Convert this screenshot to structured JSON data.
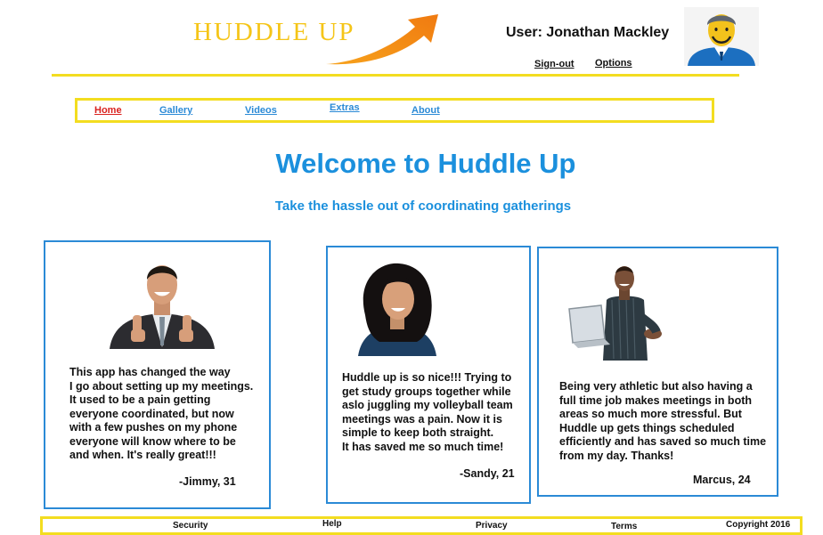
{
  "header": {
    "logo_text": "HUDDLE UP",
    "user_label": "User: Jonathan Mackley",
    "signout_label": "Sign-out",
    "options_label": "Options"
  },
  "nav": {
    "items": [
      {
        "label": "Home",
        "active": true
      },
      {
        "label": "Gallery"
      },
      {
        "label": "Videos"
      },
      {
        "label": "Extras"
      },
      {
        "label": "About"
      }
    ]
  },
  "hero": {
    "title": "Welcome to Huddle Up",
    "subtitle": "Take the hassle out of coordinating gatherings"
  },
  "testimonials": [
    {
      "lines": [
        "This app has changed the way",
        "I go about setting up my meetings.",
        "It used to be a pain getting",
        "everyone coordinated, but now",
        "with a few pushes on my phone",
        "everyone will know where to be",
        "and when. It's really great!!!"
      ],
      "signature": "-Jimmy, 31"
    },
    {
      "lines": [
        "Huddle up is so nice!!! Trying to",
        "get study groups together while",
        "aslo juggling my volleyball team",
        "meetings was a pain. Now it is",
        "simple to keep both straight.",
        "It has saved me so much time!"
      ],
      "signature": "-Sandy, 21"
    },
    {
      "lines": [
        "Being very athletic but also having a",
        "full time job makes meetings in both",
        "areas so much more stressful. But",
        "Huddle up gets things scheduled",
        "efficiently and has saved so much time",
        "from my day. Thanks!"
      ],
      "signature": "Marcus, 24"
    }
  ],
  "footer": {
    "security": "Security",
    "help": "Help",
    "privacy": "Privacy",
    "terms": "Terms",
    "copyright": "Copyright 2016"
  },
  "colors": {
    "brand_yellow": "#f3dd20",
    "accent_blue": "#1b90dd",
    "active_red": "#d9211e"
  }
}
